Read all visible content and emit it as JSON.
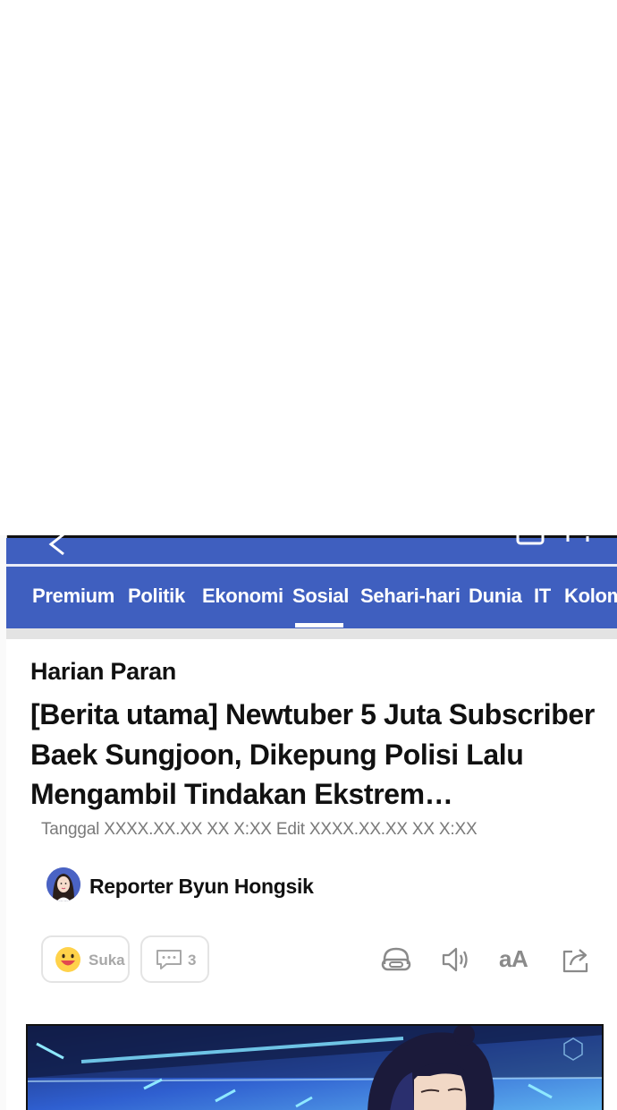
{
  "nav": {
    "items": [
      {
        "label": "Premium"
      },
      {
        "label": "Politik"
      },
      {
        "label": "Ekonomi"
      },
      {
        "label": "Sosial",
        "active": true
      },
      {
        "label": "Sehari-hari"
      },
      {
        "label": "Dunia"
      },
      {
        "label": "IT"
      },
      {
        "label": "Kolom"
      }
    ]
  },
  "article": {
    "publisher": "Harian Paran",
    "headline": "[Berita utama] Newtuber 5 Juta Subscriber Baek Sungjoon, Dikepung Polisi Lalu Mengambil Tindakan Ekstrem…",
    "dateline": "Tanggal XXXX.XX.XX XX X:XX Edit XXXX.XX.XX XX X:XX",
    "reporter": "Reporter Byun Hongsik"
  },
  "actions": {
    "like_label": "Suka",
    "comment_count": "3",
    "font_size_label": "aA"
  },
  "icons": [
    "back-icon",
    "smiley-icon",
    "comment-icon",
    "headphones-icon",
    "speaker-icon",
    "share-icon"
  ],
  "colors": {
    "nav_bg": "#3f5fbf",
    "nav_text": "#ffffff",
    "muted_text": "#7a7a7a",
    "button_border": "#e4e4e4"
  }
}
